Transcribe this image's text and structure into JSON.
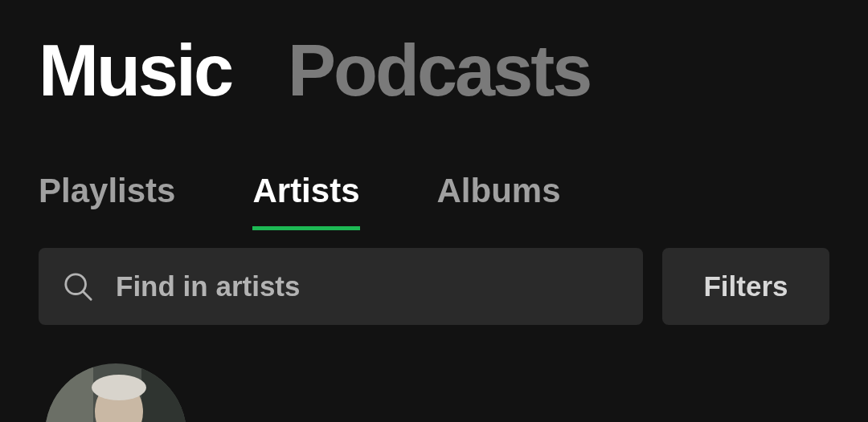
{
  "sections": [
    {
      "label": "Music",
      "selected": true
    },
    {
      "label": "Podcasts",
      "selected": false
    }
  ],
  "tabs": [
    {
      "label": "Playlists",
      "selected": false
    },
    {
      "label": "Artists",
      "selected": true
    },
    {
      "label": "Albums",
      "selected": false
    }
  ],
  "search": {
    "placeholder": "Find in artists"
  },
  "filters_button": "Filters"
}
